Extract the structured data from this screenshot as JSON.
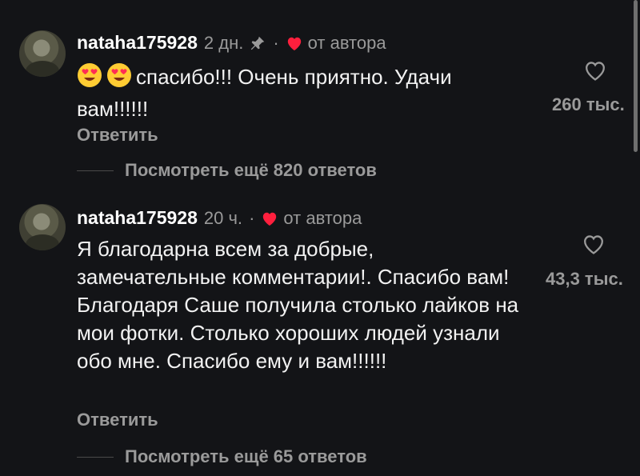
{
  "comments": [
    {
      "username": "nataha175928",
      "time": "2 дн.",
      "dot": "·",
      "author_label": "от автора",
      "text": "спасибо!!! Очень приятно. Удачи вам!!!!!!",
      "reply": "Ответить",
      "view_replies": "Посмотреть ещё 820 ответов",
      "likes": "260 тыс."
    },
    {
      "username": "nataha175928",
      "time": "20 ч.",
      "dot": "·",
      "author_label": "от автора",
      "text": "Я благодарна всем за добрые, замечательные комментарии!. Спасибо вам! Благодаря Саше получила столько лайков на мои фотки. Столько хороших людей узнали обо мне. Спасибо ему и вам!!!!!!",
      "reply": "Ответить",
      "view_replies": "Посмотреть ещё 65 ответов",
      "likes": "43,3 тыс."
    }
  ],
  "icons": {
    "pin": "pin-icon",
    "author_heart": "heart-filled-icon",
    "like": "heart-outline-icon",
    "emoji": "heart-eyes-emoji"
  },
  "colors": {
    "background": "#131417",
    "author_heart": "#ff1f3d",
    "secondary_text": "#9a9a9a"
  }
}
